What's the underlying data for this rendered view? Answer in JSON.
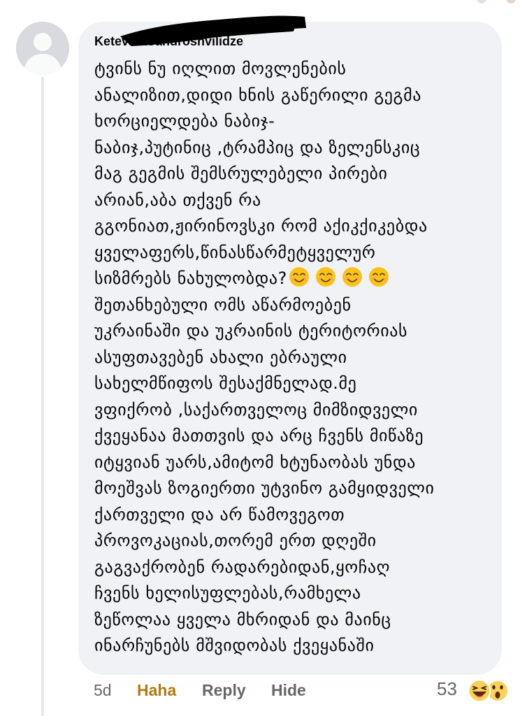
{
  "comment": {
    "author": "Ketevan Sandroshvilidze",
    "lines": [
      "ტვინს ნუ იღლით მოვლენების",
      "ანალიზით,დიდი ხნის გაწერილი გეგმა",
      "ხორციელდება ნაბიჯ-",
      "ნაბიჯ,პუტინიც ,ტრამპიც  და ზელენსკიც",
      "მაგ გეგმის შემსრულებელი პირები",
      "არიან,აბა თქვენ რა",
      "გგონიათ,ჟირინოვსკი რომ აქიკქიკებდა",
      "ყველაფერს,წინასწარმეტყველურ",
      "სიზმრებს ნახულობდა?",
      "შეთანხებული ომს აწარმოებენ",
      "უკრაინაში და უკრაინის ტერიტორიას",
      "ასუფთავებენ ახალი ებრაული",
      "სახელმწიფოს შესაქმნელად.მე",
      "ვფიქრობ ,საქართველოც მიმზიდველი",
      "ქვეყანაა მათთვის და არც ჩვენს მიწაზე",
      "იტყვიან უარს,ამიტომ ხტუნაობას უნდა",
      "მოეშვას ზოგიერთი უტვინო გამყიდველი",
      "ქართველი  და არ წამოვეგოთ",
      "პროვოკაციას,თორემ ერთ დღეში",
      "გაგვაქრობენ რადარებიდან,ყოჩაღ",
      "ჩვენს ხელისუფლებას,რამხელა",
      "ზეწოლაა ყველა მხრიდან და მაინც",
      "ინარჩუნებს მშვიდობას ქვეყანაში"
    ],
    "emoji_line_index": 8,
    "emojis": [
      "smiling-face-emoji",
      "smiling-face-emoji",
      "smiling-face-emoji",
      "smiling-face-emoji"
    ]
  },
  "actions": {
    "time": "5d",
    "reaction_label": "Haha",
    "reply_label": "Reply",
    "hide_label": "Hide"
  },
  "reactions": {
    "count": "53",
    "icons": [
      "haha-reaction-icon",
      "wow-reaction-icon"
    ]
  },
  "colors": {
    "bubble": "#f0f2f5",
    "haha_active": "#b07a16",
    "secondary_text": "#65676b",
    "redaction": "#000000"
  }
}
